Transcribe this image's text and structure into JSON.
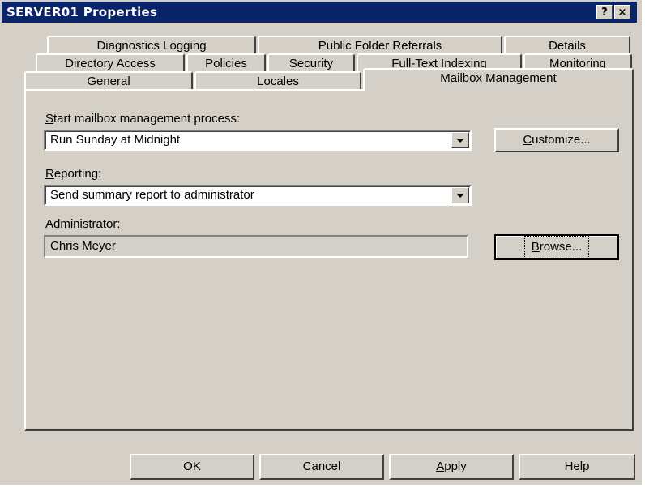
{
  "window": {
    "title": "SERVER01 Properties",
    "help_button": "?",
    "close_button": "×"
  },
  "tabs": {
    "row1": [
      "Diagnostics Logging",
      "Public Folder Referrals",
      "Details"
    ],
    "row2": [
      "Directory Access",
      "Policies",
      "Security",
      "Full-Text Indexing",
      "Monitoring"
    ],
    "row3": [
      "General",
      "Locales",
      "Mailbox Management"
    ],
    "active": "Mailbox Management"
  },
  "mailbox": {
    "start_label_key": "S",
    "start_label_rest": "tart mailbox management process:",
    "start_value": "Run Sunday at Midnight",
    "customize_key": "C",
    "customize_rest": "ustomize...",
    "reporting_key": "R",
    "reporting_rest": "eporting:",
    "reporting_value": "Send summary report to administrator",
    "admin_label": "Administrator:",
    "admin_value": "Chris Meyer",
    "browse_key": "B",
    "browse_rest": "rowse..."
  },
  "footer": {
    "ok": "OK",
    "cancel": "Cancel",
    "apply_key": "A",
    "apply_rest": "pply",
    "help": "Help"
  },
  "icons": [
    "help-icon",
    "close-icon",
    "dropdown-arrow-icon"
  ],
  "colors": {
    "title_bar": "#0a246a",
    "face": "#d4d0c8"
  }
}
